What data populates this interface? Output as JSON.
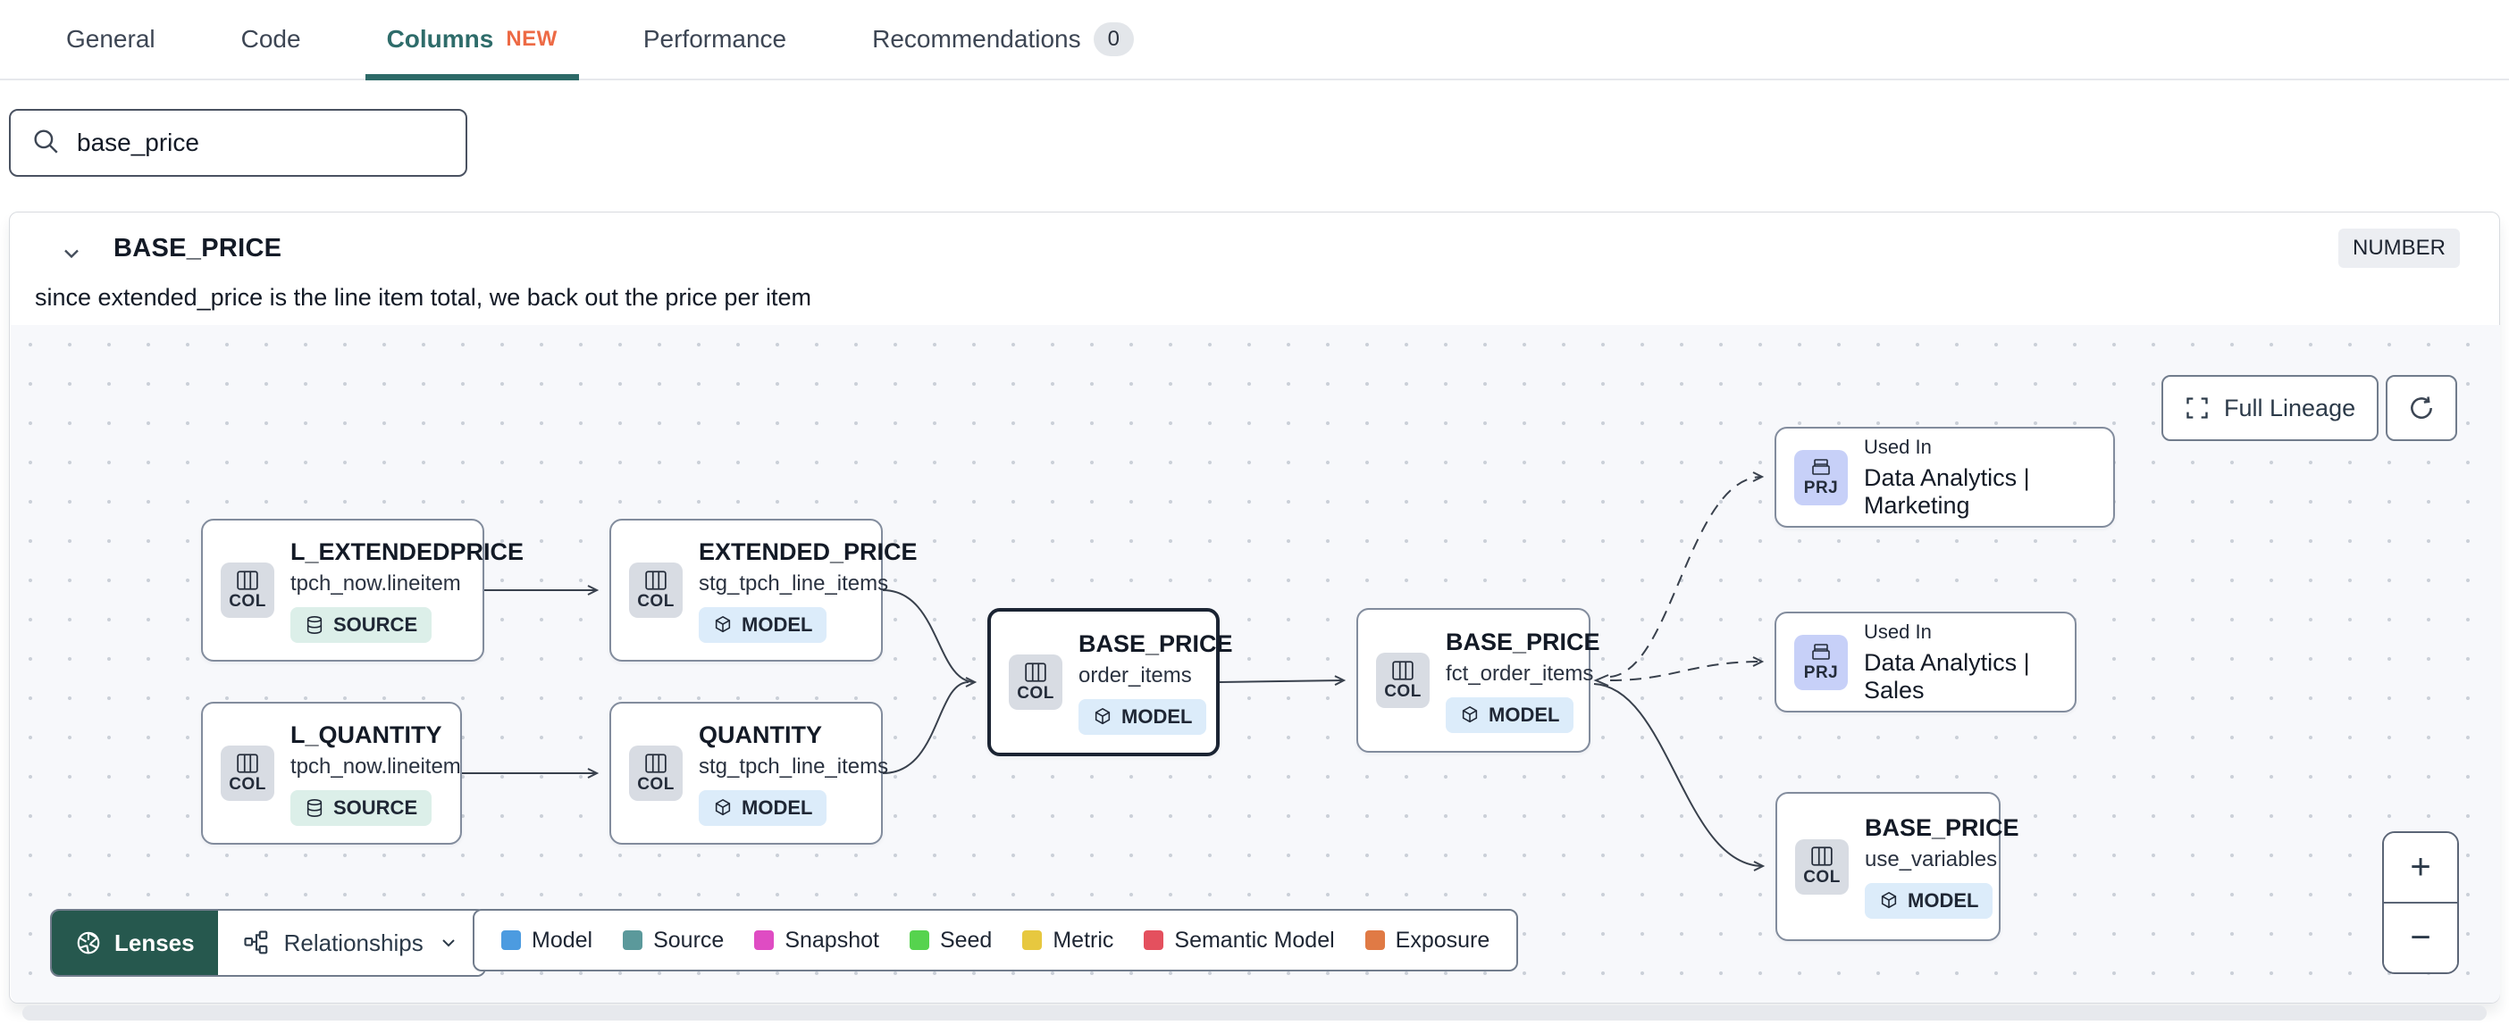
{
  "tabs": {
    "general": "General",
    "code": "Code",
    "columns": "Columns",
    "columns_badge": "NEW",
    "performance": "Performance",
    "recommendations": "Recommendations",
    "recommendations_count": "0"
  },
  "search": {
    "value": "base_price"
  },
  "column": {
    "name": "BASE_PRICE",
    "type": "NUMBER",
    "description": "since extended_price is the line item total, we back out the price per item"
  },
  "toolbar": {
    "full_lineage": "Full Lineage"
  },
  "nodes": [
    {
      "badge": "COL",
      "title": "L_EXTENDEDPRICE",
      "subtitle": "tpch_now.lineitem",
      "tag": "SOURCE"
    },
    {
      "badge": "COL",
      "title": "EXTENDED_PRICE",
      "subtitle": "stg_tpch_line_items",
      "tag": "MODEL"
    },
    {
      "badge": "COL",
      "title": "L_QUANTITY",
      "subtitle": "tpch_now.lineitem",
      "tag": "SOURCE"
    },
    {
      "badge": "COL",
      "title": "QUANTITY",
      "subtitle": "stg_tpch_line_items",
      "tag": "MODEL"
    },
    {
      "badge": "COL",
      "title": "BASE_PRICE",
      "subtitle": "order_items",
      "tag": "MODEL"
    },
    {
      "badge": "COL",
      "title": "BASE_PRICE",
      "subtitle": "fct_order_items",
      "tag": "MODEL"
    },
    {
      "badge": "PRJ",
      "title": "Used In",
      "subtitle": "Data Analytics | Marketing"
    },
    {
      "badge": "PRJ",
      "title": "Used In",
      "subtitle": "Data Analytics | Sales"
    },
    {
      "badge": "COL",
      "title": "BASE_PRICE",
      "subtitle": "use_variables",
      "tag": "MODEL"
    }
  ],
  "controls": {
    "lenses": "Lenses",
    "relationships": "Relationships",
    "zoom_in": "+",
    "zoom_out": "−"
  },
  "legend": {
    "items": [
      {
        "label": "Model",
        "color": "#4c9be0"
      },
      {
        "label": "Source",
        "color": "#5b999b"
      },
      {
        "label": "Snapshot",
        "color": "#df4cc3"
      },
      {
        "label": "Seed",
        "color": "#56d34e"
      },
      {
        "label": "Metric",
        "color": "#e7c83f"
      },
      {
        "label": "Semantic Model",
        "color": "#e4505e"
      },
      {
        "label": "Exposure",
        "color": "#e07a45"
      }
    ]
  }
}
